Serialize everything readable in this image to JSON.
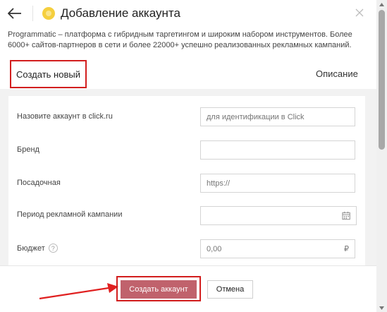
{
  "header": {
    "title": "Добавление аккаунта",
    "back_icon": "arrow-left-icon",
    "logo_icon": "programmatic-logo-icon",
    "close_icon": "close-icon"
  },
  "description": "Programmatic – платформа с гибридным таргетингом и широким набором инструментов. Более 6000+ сайтов-партнеров в сети и более 22000+ успешно реализованных рекламных кампаний.",
  "tabs": [
    {
      "label": "Создать новый",
      "active": true
    },
    {
      "label": "Описание",
      "active": false
    }
  ],
  "form": {
    "account_name": {
      "label": "Назовите аккаунт в click.ru",
      "placeholder": "для идентификации в Click",
      "value": ""
    },
    "brand": {
      "label": "Бренд",
      "placeholder": "",
      "value": ""
    },
    "landing": {
      "label": "Посадочная",
      "placeholder": "https://",
      "value": ""
    },
    "period": {
      "label": "Период рекламной кампании",
      "placeholder": "",
      "value": "",
      "icon": "calendar-icon"
    },
    "budget": {
      "label": "Бюджет",
      "placeholder": "0,00",
      "value": "",
      "currency": "₽",
      "help_icon": "question-circle-icon",
      "help_symbol": "?"
    }
  },
  "footer": {
    "create_label": "Создать аккаунт",
    "cancel_label": "Отмена"
  },
  "colors": {
    "accent_button": "#c0626c",
    "highlight": "#d21e1e",
    "logo": "#f5cf3e"
  }
}
